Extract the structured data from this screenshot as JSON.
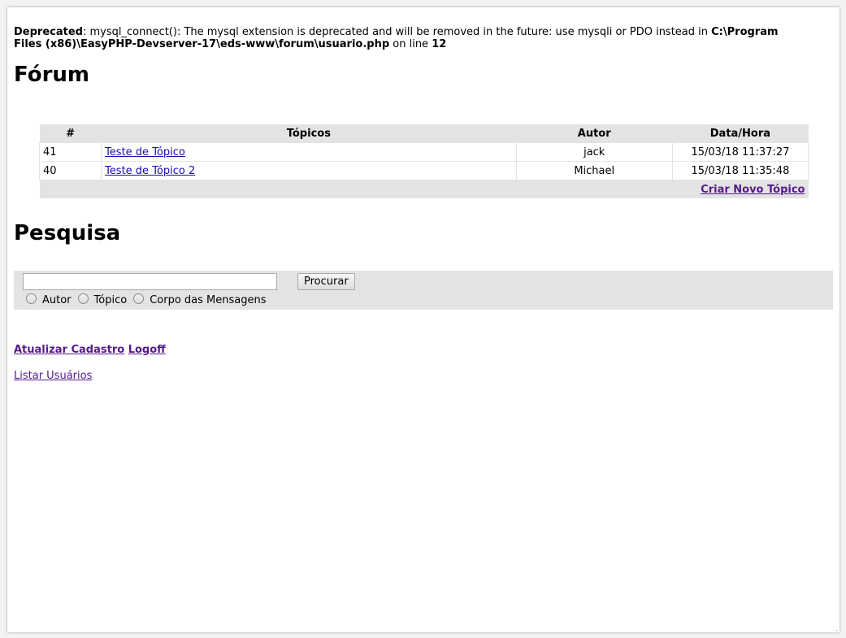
{
  "deprecated": {
    "label": "Deprecated",
    "message": ": mysql_connect(): The mysql extension is deprecated and will be removed in the future: use mysqli or PDO instead in ",
    "path": "C:\\Program Files (x86)\\EasyPHP-Devserver-17\\eds-www\\forum\\usuario.php",
    "on_line": " on line ",
    "line": "12"
  },
  "forum": {
    "title": "Fórum",
    "columns": [
      "#",
      "Tópicos",
      "Autor",
      "Data/Hora"
    ],
    "rows": [
      {
        "id": "41",
        "topic": "Teste de Tópico",
        "author": "jack",
        "datetime": "15/03/18 11:37:27"
      },
      {
        "id": "40",
        "topic": "Teste de Tópico 2",
        "author": "Michael",
        "datetime": "15/03/18 11:35:48"
      }
    ],
    "new_topic_label": "Criar Novo Tópico"
  },
  "search": {
    "title": "Pesquisa",
    "input_value": "",
    "button_label": "Procurar",
    "options": [
      "Autor",
      "Tópico",
      "Corpo das Mensagens"
    ]
  },
  "links": {
    "update_profile": "Atualizar Cadastro",
    "logoff": "Logoff",
    "list_users": "Listar Usuários"
  },
  "colors": {
    "link": "#1a0dab",
    "visited_link": "#551a8b",
    "panel_bg": "#e3e3e3"
  }
}
